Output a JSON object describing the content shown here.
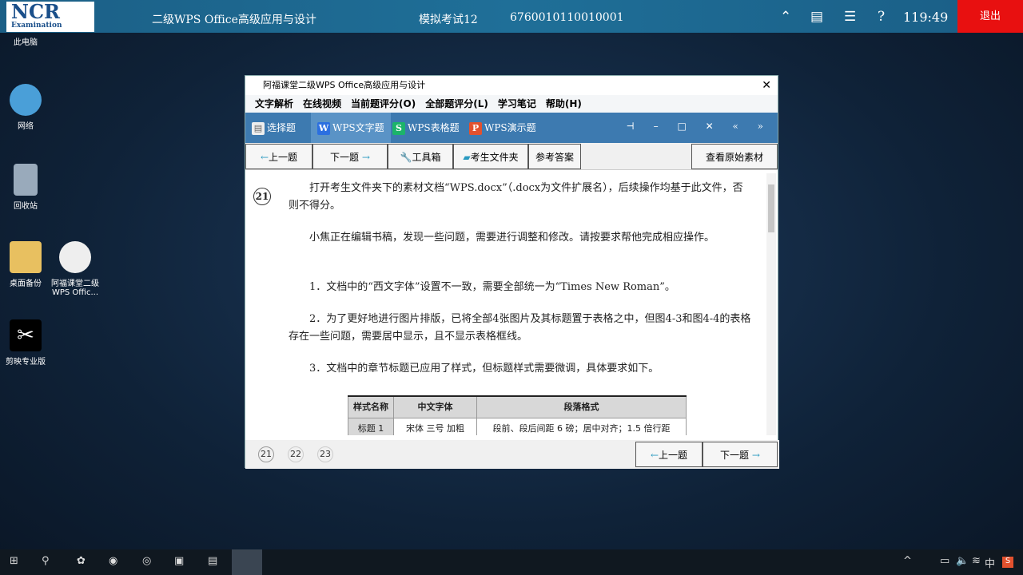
{
  "topbar": {
    "logo": "NCR",
    "logo_sub": "Examination",
    "exam_title": "二级WPS Office高级应用与设计",
    "exam_name": "模拟考试12",
    "exam_id": "6760010110010001",
    "timer": "119:49",
    "exit": "退出"
  },
  "desktop": [
    "此电脑",
    "网络",
    "回收站",
    "桌面备份",
    "阿福课堂二级WPS Offic...",
    "剪映专业版"
  ],
  "window": {
    "title": "阿福课堂二级WPS Office高级应用与设计",
    "menu": [
      "文字解析",
      "在线视频",
      "当前题评分(O)",
      "全部题评分(L)",
      "学习笔记",
      "帮助(H)"
    ],
    "tabs": [
      "选择题",
      "WPS文字题",
      "WPS表格题",
      "WPS演示题"
    ],
    "tools": {
      "prev": "上一题",
      "next": "下一题",
      "toolbox": "工具箱",
      "folder": "考生文件夹",
      "answer": "参考答案",
      "original": "查看原始素材"
    },
    "question_number": "21",
    "paragraphs": [
      "打开考生文件夹下的素材文档“WPS.docx”（.docx为文件扩展名），后续操作均基于此文件，否则不得分。",
      "小焦正在编辑书稿，发现一些问题，需要进行调整和修改。请按要求帮他完成相应操作。",
      "1．文档中的“西文字体”设置不一致，需要全部统一为“Times New Roman”。",
      "2．为了更好地进行图片排版，已将全部4张图片及其标题置于表格之中，但图4-3和图4-4的表格存在一些问题，需要居中显示，且不显示表格框线。",
      "3．文档中的章节标题已应用了样式，但标题样式需要微调，具体要求如下。"
    ],
    "table": {
      "headers": [
        "样式名称",
        "中文字体",
        "段落格式"
      ],
      "rows": [
        [
          "标题 1",
          "宋体  三号  加粗",
          "段前、段后间距 6 磅；居中对齐；1.5 倍行距"
        ]
      ]
    },
    "pages": [
      "21",
      "22",
      "23"
    ],
    "bottom_prev": "上一题",
    "bottom_next": "下一题"
  },
  "taskbar": {
    "ime": "中"
  }
}
